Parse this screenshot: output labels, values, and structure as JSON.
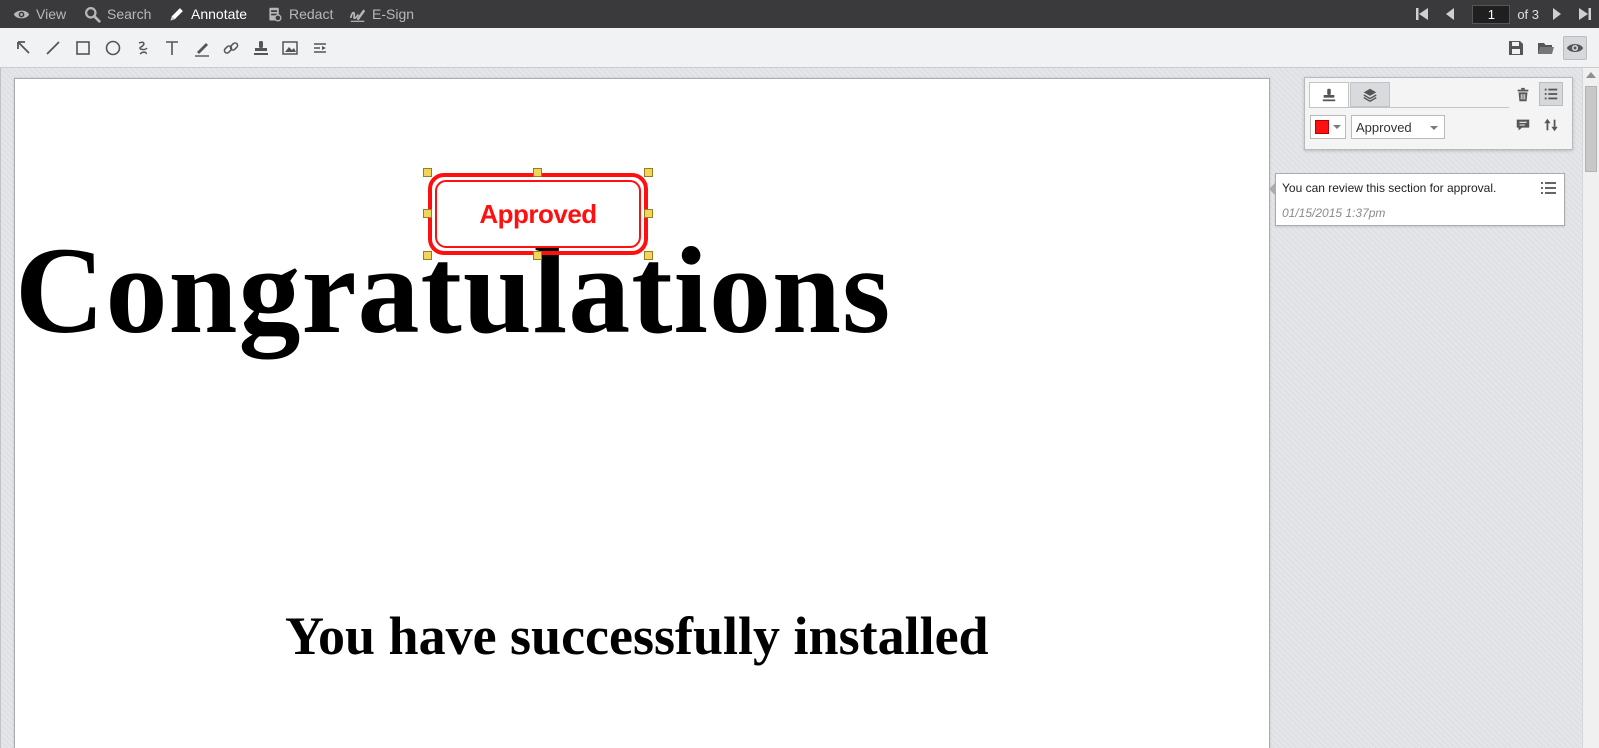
{
  "modes": [
    {
      "label": "View",
      "icon": "eye-icon"
    },
    {
      "label": "Search",
      "icon": "search-icon"
    },
    {
      "label": "Annotate",
      "icon": "pencil-icon"
    },
    {
      "label": "Redact",
      "icon": "redact-icon"
    },
    {
      "label": "E-Sign",
      "icon": "signature-icon"
    }
  ],
  "active_mode": "Annotate",
  "pager": {
    "current_page": "1",
    "of_label": "of 3"
  },
  "tools": [
    "arrow-select-icon",
    "line-icon",
    "rectangle-icon",
    "ellipse-icon",
    "freehand-icon",
    "text-icon",
    "highlighter-icon",
    "link-icon",
    "stamp-icon",
    "image-icon",
    "line-style-icon"
  ],
  "right_tools": [
    "save-icon",
    "open-folder-icon",
    "eye-icon"
  ],
  "document": {
    "headline": "Congratulations",
    "subline": "You have successfully installed"
  },
  "stamp": {
    "text": "Approved",
    "color": "#ff1010"
  },
  "panel": {
    "tabs": [
      "stamp-tab-icon",
      "layers-tab-icon"
    ],
    "selected_color": "#ff1010",
    "stamp_type": "Approved"
  },
  "comment": {
    "text": "You can review this section for approval.",
    "date": "01/15/2015 1:37pm"
  }
}
